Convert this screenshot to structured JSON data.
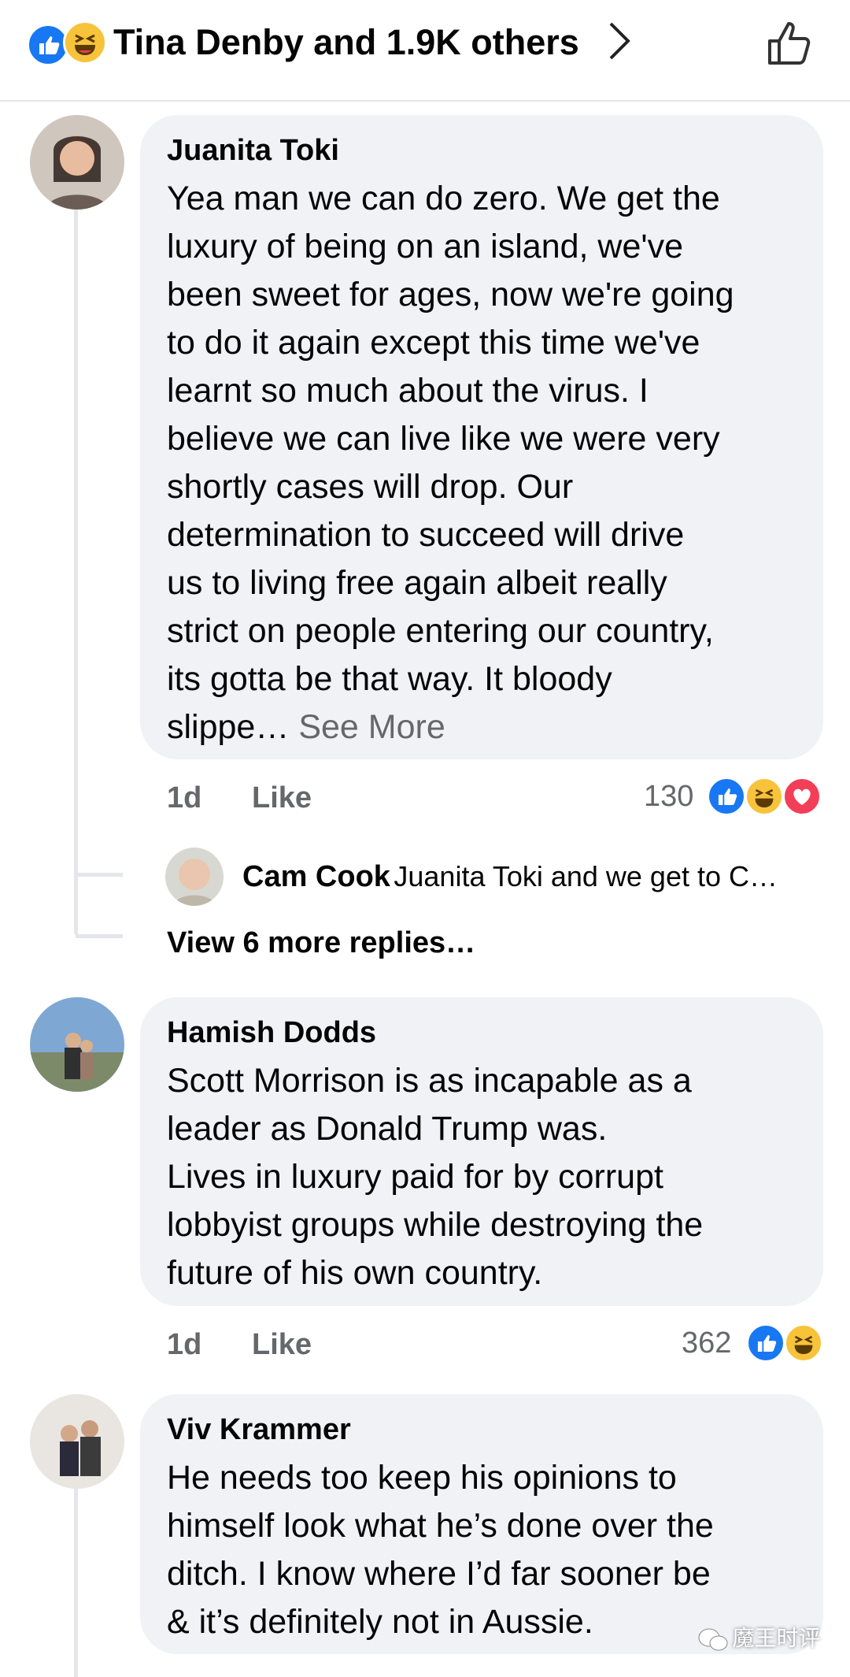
{
  "header": {
    "title": "Tina Denby and 1.9K others",
    "reaction_icons": [
      "like-icon",
      "haha-icon"
    ]
  },
  "comments": [
    {
      "name": "Juanita Toki",
      "text": "Yea man we can do zero. We get the\nluxury of being on an island, we've\nbeen sweet for ages, now we're going\nto do it again except this time we've\nlearnt so much about the virus.  I\nbelieve we can live like we were very\nshortly cases will drop. Our\ndetermination to succeed will drive\nus to living free again albeit really\nstrict on people entering our country,\nits gotta be that way. It bloody\nslippe…",
      "see_more": "See More",
      "time": "1d",
      "like": "Like",
      "reactions_count": "130",
      "reaction_icons": [
        "like-icon",
        "haha-icon",
        "love-icon"
      ],
      "reply_preview": {
        "name": "Cam Cook",
        "text": "Juanita Toki and we get to C…"
      },
      "view_more": "View 6 more replies…"
    },
    {
      "name": "Hamish Dodds",
      "text": "Scott Morrison is as incapable as a\nleader as Donald Trump was.\nLives in luxury paid for by corrupt\nlobbyist groups while destroying the\nfuture of his own country.",
      "time": "1d",
      "like": "Like",
      "reactions_count": "362",
      "reaction_icons": [
        "like-icon",
        "haha-icon"
      ]
    },
    {
      "name": "Viv Krammer",
      "text": "He needs too keep his opinions to\nhimself look what he’s done over the\nditch. I know where I’d far sooner be\n& it’s definitely not in Aussie."
    }
  ],
  "watermark": "魔王时评",
  "colors": {
    "like_blue": "#1877f2",
    "haha_yellow": "#f7c33b",
    "love_red": "#f33e58",
    "bubble_bg": "#f0f2f5",
    "meta_gray": "#65676b"
  }
}
